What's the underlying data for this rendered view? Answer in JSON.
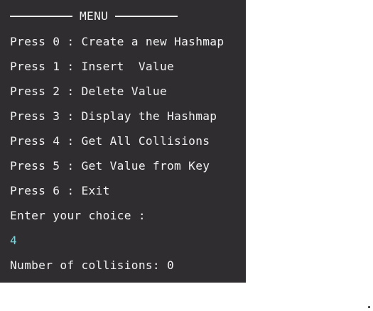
{
  "terminal": {
    "menu_title": "MENU",
    "options": [
      {
        "label": "Press 0 : Create a new Hashmap"
      },
      {
        "label": "Press 1 : Insert  Value"
      },
      {
        "label": "Press 2 : Delete Value"
      },
      {
        "label": "Press 3 : Display the Hashmap"
      },
      {
        "label": "Press 4 : Get All Collisions"
      },
      {
        "label": "Press 5 : Get Value from Key"
      },
      {
        "label": "Press 6 : Exit"
      }
    ],
    "prompt": "Enter your choice :",
    "input_value": "4",
    "output": "Number of collisions: 0"
  },
  "colors": {
    "terminal_background": "#2f2d30",
    "text": "#f2f2f2",
    "input_text": "#7fd3d8"
  }
}
